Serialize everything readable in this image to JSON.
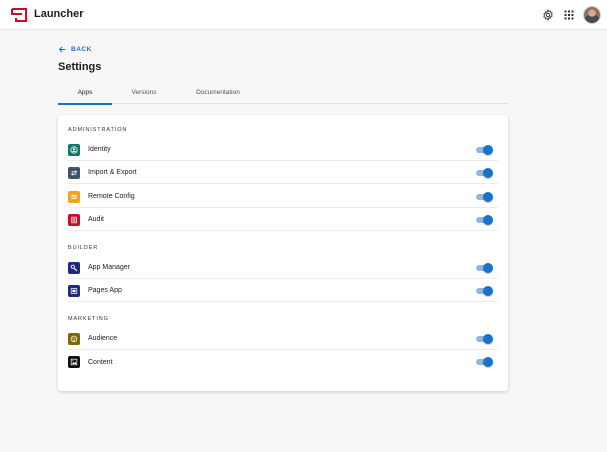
{
  "header": {
    "app_title": "Launcher",
    "icons": [
      "launcher-logo",
      "settings-icon",
      "apps-grid-icon",
      "user-avatar"
    ]
  },
  "nav": {
    "back_label": "BACK"
  },
  "page": {
    "title": "Settings"
  },
  "tabs": [
    {
      "label": "Apps",
      "active": true
    },
    {
      "label": "Versions",
      "active": false
    },
    {
      "label": "Documentation",
      "active": false
    }
  ],
  "sections": [
    {
      "title": "ADMINISTRATION",
      "items": [
        {
          "label": "Identity",
          "icon": "identity-icon",
          "color": "#0f7a6c",
          "enabled": true
        },
        {
          "label": "Import & Export",
          "icon": "import-export-icon",
          "color": "#3d5766",
          "enabled": true
        },
        {
          "label": "Remote Config",
          "icon": "remote-config-icon",
          "color": "#f2a21f",
          "enabled": true
        },
        {
          "label": "Audit",
          "icon": "audit-icon",
          "color": "#c8102e",
          "enabled": true
        }
      ]
    },
    {
      "title": "BUILDER",
      "items": [
        {
          "label": "App Manager",
          "icon": "app-manager-icon",
          "color": "#1f2a7a",
          "enabled": true
        },
        {
          "label": "Pages App",
          "icon": "pages-app-icon",
          "color": "#1f2a7a",
          "enabled": true
        }
      ]
    },
    {
      "title": "MARKETING",
      "items": [
        {
          "label": "Audience",
          "icon": "audience-icon",
          "color": "#7a6a00",
          "enabled": true
        },
        {
          "label": "Content",
          "icon": "content-icon",
          "color": "#111111",
          "enabled": true
        }
      ]
    }
  ],
  "colors": {
    "accent": "#1a73c8",
    "toggle_track": "#8db8e6",
    "brand": "#c8102e"
  }
}
